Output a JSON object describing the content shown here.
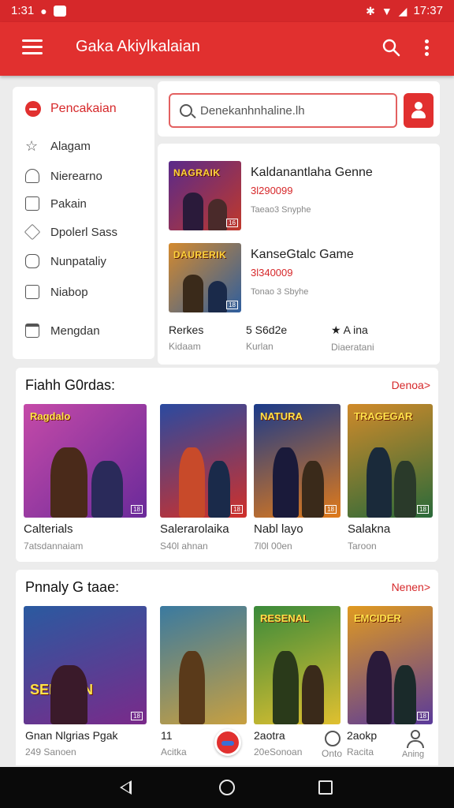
{
  "status_bar": {
    "time_left": "1:31",
    "time_right": "17:37"
  },
  "app_bar": {
    "title": "Gaka Akiylkalaian"
  },
  "sidebar": {
    "header": "Pencakaian",
    "items": [
      {
        "label": "Alagam",
        "icon": "star-outline-icon"
      },
      {
        "label": "Nierearno",
        "icon": "triangle-icon"
      },
      {
        "label": "Pakain",
        "icon": "document-icon"
      },
      {
        "label": "Dpolerl Sass",
        "icon": "diamond-icon"
      },
      {
        "label": "Nunpataliy",
        "icon": "puzzle-icon"
      },
      {
        "label": "Niabop",
        "icon": "edit-icon"
      },
      {
        "label": "Mengdan",
        "icon": "window-icon"
      }
    ]
  },
  "search": {
    "placeholder": "Denekanhnhaline.lh"
  },
  "featured": {
    "items": [
      {
        "name": "Kaldanantlaha Genne",
        "price": "3l290099",
        "meta": "Taeao3 Snyphe",
        "thumb_title": "NAGRAIK",
        "bg": [
          "#5a2a8a",
          "#c0392b"
        ]
      },
      {
        "name": "KanseGtalc Game",
        "price": "3l340009",
        "meta": "Tonao 3 Sbyhe",
        "thumb_title": "DAURERIK",
        "bg": [
          "#2e5e9e",
          "#d48a2e"
        ]
      }
    ],
    "stats": [
      {
        "value": "Rerkes",
        "label": "Kidaam"
      },
      {
        "value": "5 S6d2e",
        "label": "Kurlan"
      },
      {
        "value": "★ A ina",
        "label": "Diaeratani"
      }
    ]
  },
  "fresh_section": {
    "title": "Fiahh G0rdas:",
    "link": "Denoa>",
    "cards": [
      {
        "name": "Calterials",
        "sub": "7atsdannaiam",
        "art_title": "Ragdalo",
        "bg": [
          "#c54aa8",
          "#6a2a9a"
        ]
      },
      {
        "name": "Salerarolaika",
        "sub": "S40l ahnan",
        "art_title": "",
        "bg": [
          "#2a4aa0",
          "#d0302a"
        ]
      },
      {
        "name": "Nabl layo",
        "sub": "7l0l 00en",
        "art_title": "NATURA",
        "bg": [
          "#1a3a8a",
          "#e07a1a"
        ]
      },
      {
        "name": "Salakna",
        "sub": "Taroon",
        "art_title": "TRAGEGAR",
        "bg": [
          "#2a6a3a",
          "#d08a2a"
        ]
      }
    ]
  },
  "popular_section": {
    "title": "Pnnaly G taae:",
    "link": "Nenen>",
    "cards": [
      {
        "name": "Gnan Nlgrias Pgak",
        "sub": "249 Sanoen",
        "art_title": "SENEAIN",
        "bg": [
          "#2a5aa0",
          "#7a2a8a"
        ]
      },
      {
        "name": "11",
        "sub": "Acitka",
        "art_title": "",
        "bg": [
          "#3a7aa0",
          "#c8a040"
        ]
      },
      {
        "name": "2aotra",
        "sub": "20eSonoan",
        "art_title": "RESENAL",
        "bg": [
          "#3a8a3a",
          "#e0c030"
        ]
      },
      {
        "name": "2aokp",
        "sub": "Racita",
        "art_title": "EMCIDER",
        "bg": [
          "#5a3a9a",
          "#e09a20"
        ]
      }
    ]
  },
  "bottom_strip": {
    "clock_label": "Onto",
    "account_label": "Aning"
  },
  "colors": {
    "accent": "#e1302f",
    "status": "#d6282a"
  }
}
